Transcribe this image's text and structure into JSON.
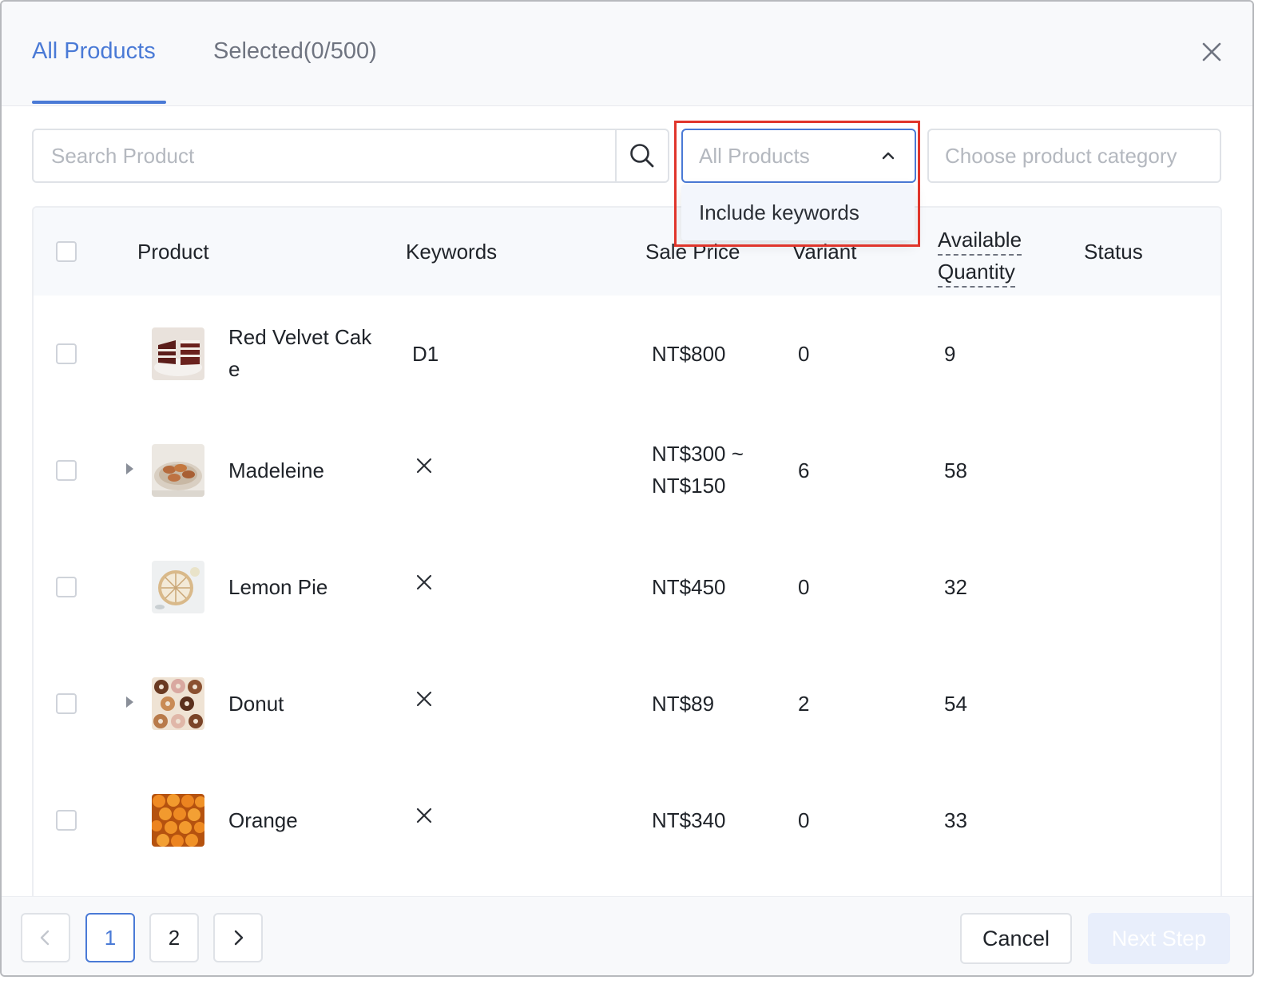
{
  "header": {
    "tabs": [
      {
        "label": "All Products",
        "active": true
      },
      {
        "label": "Selected(0/500)",
        "active": false
      }
    ]
  },
  "filters": {
    "search_placeholder": "Search Product",
    "filter_select_value": "All Products",
    "dropdown_options": [
      "Include keywords"
    ],
    "category_placeholder": "Choose product category"
  },
  "table": {
    "columns": {
      "product": "Product",
      "keywords": "Keywords",
      "sale_price": "Sale Price",
      "variant": "Variant",
      "available_quantity_line1": "Available",
      "available_quantity_line2": "Quantity",
      "status": "Status"
    },
    "rows": [
      {
        "name_line1": "Red Velvet Cak",
        "name_line2": "e",
        "keywords": "D1",
        "price_line1": "NT$800",
        "price_line2": "",
        "variant": "0",
        "quantity": "9",
        "expandable": false
      },
      {
        "name_line1": "Madeleine",
        "name_line2": "",
        "keywords": "",
        "price_line1": "NT$300 ~",
        "price_line2": "NT$150",
        "variant": "6",
        "quantity": "58",
        "expandable": true
      },
      {
        "name_line1": "Lemon Pie",
        "name_line2": "",
        "keywords": "",
        "price_line1": "NT$450",
        "price_line2": "",
        "variant": "0",
        "quantity": "32",
        "expandable": false
      },
      {
        "name_line1": "Donut",
        "name_line2": "",
        "keywords": "",
        "price_line1": "NT$89",
        "price_line2": "",
        "variant": "2",
        "quantity": "54",
        "expandable": true
      },
      {
        "name_line1": "Orange",
        "name_line2": "",
        "keywords": "",
        "price_line1": "NT$340",
        "price_line2": "",
        "variant": "0",
        "quantity": "33",
        "expandable": false
      }
    ]
  },
  "pagination": {
    "pages": [
      "1",
      "2"
    ],
    "current": "1"
  },
  "footer": {
    "cancel_label": "Cancel",
    "next_label": "Next Step"
  },
  "colors": {
    "accent": "#4a7ad6",
    "highlight": "#e0352b"
  }
}
